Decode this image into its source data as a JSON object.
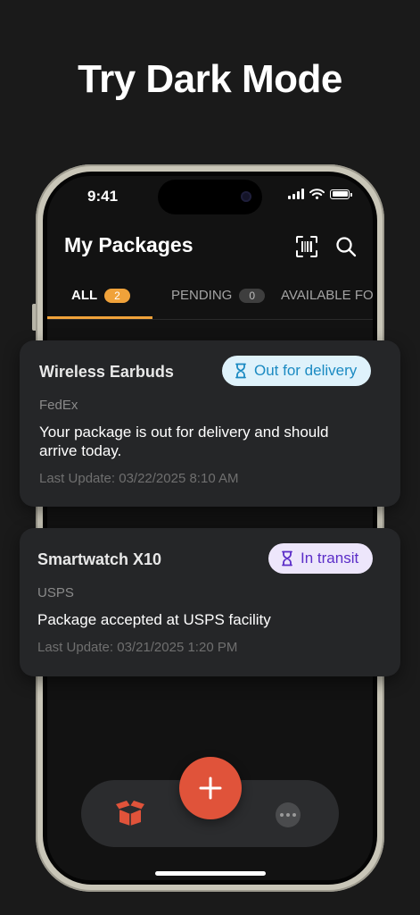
{
  "headline": "Try Dark Mode",
  "status_bar": {
    "time": "9:41"
  },
  "app": {
    "title": "My Packages",
    "icons": {
      "scan": "barcode-scan-icon",
      "search": "search-icon"
    }
  },
  "tabs": [
    {
      "label": "ALL",
      "count": "2",
      "active": true
    },
    {
      "label": "PENDING",
      "count": "0",
      "active": false
    },
    {
      "label": "AVAILABLE FOR",
      "active": false
    }
  ],
  "packages": [
    {
      "name": "Wireless Earbuds",
      "status": "Out for delivery",
      "carrier": "FedEx",
      "message": "Your package is out for delivery and should arrive today.",
      "last_update": "Last Update: 03/22/2025 8:10 AM"
    },
    {
      "name": "Smartwatch X10",
      "status": "In transit",
      "carrier": "USPS",
      "message": "Package accepted at USPS facility",
      "last_update": "Last Update: 03/21/2025 1:20 PM"
    }
  ],
  "colors": {
    "accent": "#f0a23a",
    "fab": "#e0533a",
    "delivery_text": "#1b8ac2",
    "transit_text": "#5b2dc8"
  },
  "bottom_nav": {
    "left_icon": "package-box-icon",
    "center_icon": "plus-icon",
    "right_icon": "more-icon"
  }
}
